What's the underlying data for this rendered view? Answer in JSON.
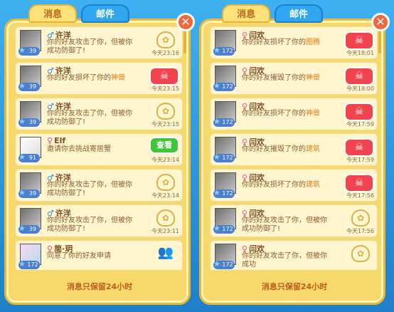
{
  "left": {
    "tabs": [
      "消息",
      "邮件"
    ],
    "footer": "消息只保留24小时",
    "items": [
      {
        "name": "许洋",
        "gender": "♂",
        "level": "39",
        "msg_pre": "你的好友攻击了你，但被你成功防御了!",
        "msg_hl": "",
        "time": "今天23:16",
        "action": "bag",
        "avatar": "plain"
      },
      {
        "name": "许洋",
        "gender": "♂",
        "level": "39",
        "msg_pre": "你的好友损坏了你的",
        "msg_hl": "神兽",
        "time": "今天23:15",
        "action": "red",
        "avatar": "plain"
      },
      {
        "name": "许洋",
        "gender": "♂",
        "level": "39",
        "msg_pre": "你的好友攻击了你，但被你成功防御了!",
        "msg_hl": "",
        "time": "今天23:15",
        "action": "bag",
        "avatar": "plain"
      },
      {
        "name": "Elf",
        "gender": "♀",
        "level": "91",
        "msg_pre": "邀请你去挑战寄居蟹",
        "msg_hl": "",
        "time": "今天23:14",
        "action": "green",
        "avatar": "girl"
      },
      {
        "name": "许洋",
        "gender": "♂",
        "level": "39",
        "msg_pre": "你的好友攻击了你，但被你成功防御了!",
        "msg_hl": "",
        "time": "今天23:14",
        "action": "bag",
        "avatar": "plain"
      },
      {
        "name": "许洋",
        "gender": "♂",
        "level": "39",
        "msg_pre": "你的好友攻击了你，但被你成功防御了!",
        "msg_hl": "",
        "time": "今天23:11",
        "action": "bag",
        "avatar": "plain"
      },
      {
        "name": "简·玥",
        "gender": "♀",
        "level": "172",
        "msg_pre": "同意了你的好友申请",
        "msg_hl": "",
        "time": "",
        "action": "friends",
        "avatar": "pink"
      }
    ],
    "green_label": "查看"
  },
  "right": {
    "tabs": [
      "消息",
      "邮件"
    ],
    "footer": "消息只保留24小时",
    "items": [
      {
        "name": "闫欢",
        "gender": "♀",
        "level": "172",
        "msg_pre": "你的好友损坏了你的",
        "msg_hl": "图腾",
        "time": "今天18:01",
        "action": "red"
      },
      {
        "name": "闫欢",
        "gender": "♀",
        "level": "172",
        "msg_pre": "你的好友摧毁了你的",
        "msg_hl": "神兽",
        "time": "今天18:00",
        "action": "red"
      },
      {
        "name": "闫欢",
        "gender": "♀",
        "level": "172",
        "msg_pre": "你的好友损坏了你的",
        "msg_hl": "神兽",
        "time": "今天17:59",
        "action": "red"
      },
      {
        "name": "闫欢",
        "gender": "♀",
        "level": "172",
        "msg_pre": "你的好友摧毁了你的",
        "msg_hl": "建筑",
        "time": "今天17:59",
        "action": "red"
      },
      {
        "name": "闫欢",
        "gender": "♀",
        "level": "172",
        "msg_pre": "你的好友损坏了你的",
        "msg_hl": "建筑",
        "time": "今天17:56",
        "action": "red"
      },
      {
        "name": "闫欢",
        "gender": "♀",
        "level": "172",
        "msg_pre": "你的好友攻击了你，但被你成功防御了!",
        "msg_hl": "",
        "time": "今天17:56",
        "action": "bag"
      },
      {
        "name": "闫欢",
        "gender": "♀",
        "level": "172",
        "msg_pre": "你的好友攻击了你，但被你成功",
        "msg_hl": "",
        "time": "",
        "action": "bag"
      }
    ]
  }
}
